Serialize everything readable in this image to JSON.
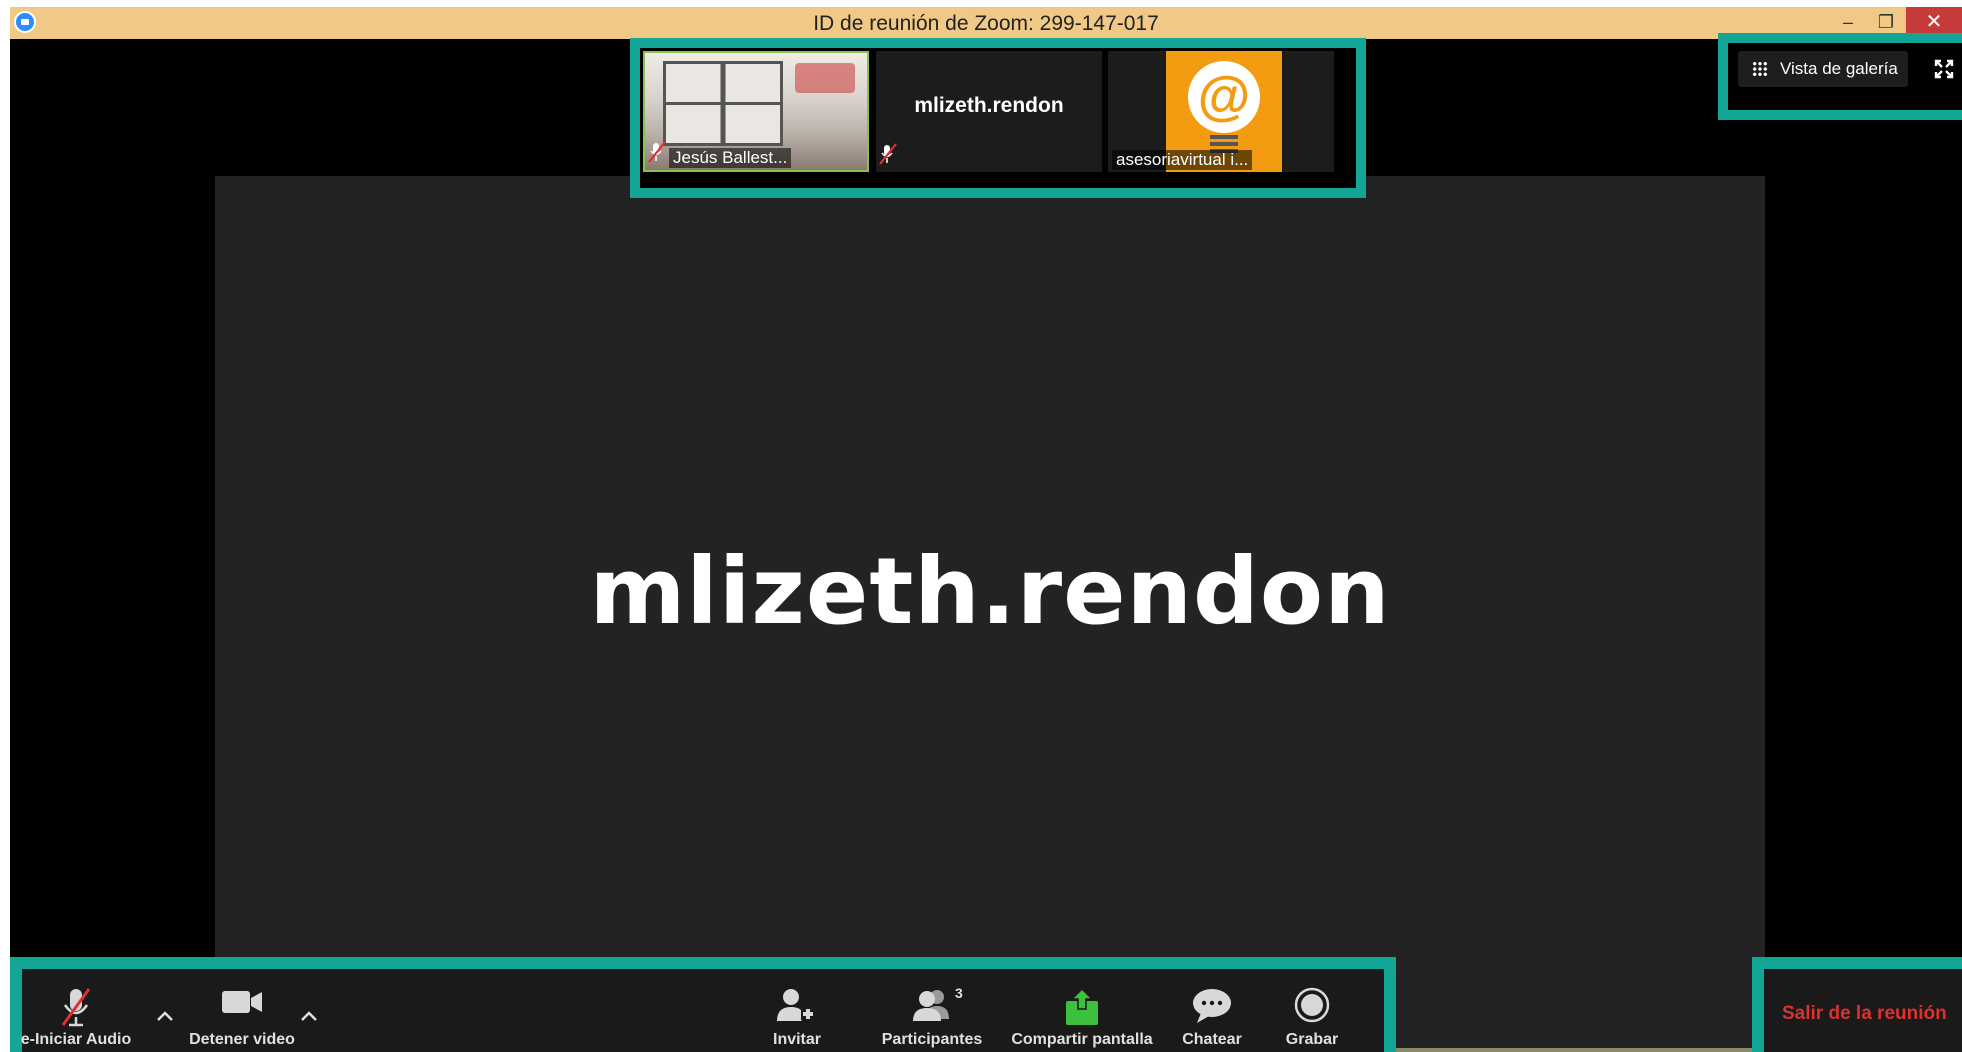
{
  "window": {
    "title": "ID de reunión de Zoom: 299-147-017",
    "minimize": "–",
    "restore": "❐",
    "close": "✕"
  },
  "active_speaker": {
    "name": "mlizeth.rendon"
  },
  "thumbnails": [
    {
      "label": "Jesús Ballest...",
      "muted": true
    },
    {
      "name": "mlizeth.rendon",
      "muted": true
    },
    {
      "label": "asesoriavirtual i...",
      "avatar_glyph": "@"
    }
  ],
  "view": {
    "gallery_label": "Vista de galería"
  },
  "toolbar": {
    "audio_label": "e-Iniciar Audio",
    "video_label": "Detener video",
    "invite_label": "Invitar",
    "participants_label": "Participantes",
    "participants_count": "3",
    "share_label": "Compartir pantalla",
    "chat_label": "Chatear",
    "record_label": "Grabar",
    "leave_label": "Salir de la reunión"
  },
  "colors": {
    "highlight": "#13a596",
    "leave_red": "#e02f2f",
    "share_green": "#3cc13c",
    "titlebar": "#f0c986"
  }
}
